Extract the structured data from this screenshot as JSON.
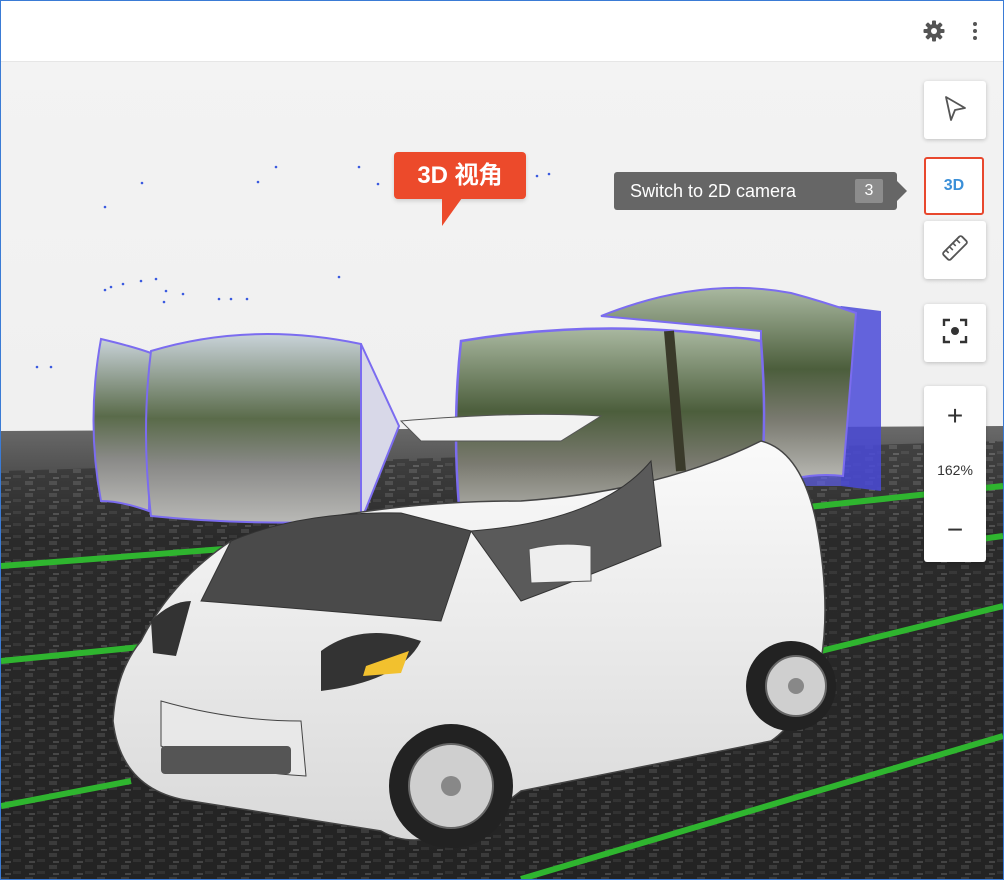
{
  "toolbar": {
    "settings_icon": "gear-icon",
    "more_icon": "more-vertical-icon"
  },
  "view_controls": {
    "select_tool_icon": "pointer-arrow-icon",
    "view_mode_label": "3D",
    "measure_tool_icon": "ruler-icon",
    "recenter_icon": "focus-target-icon",
    "zoom_in_label": "+",
    "zoom_level": "162%",
    "zoom_out_label": "−"
  },
  "tooltip": {
    "text": "Switch to 2D camera",
    "shortcut": "3"
  },
  "annotation": {
    "text": "3D 视角"
  },
  "colors": {
    "accent_red": "#ec4a2b",
    "frustum_purple": "#7b6cf0",
    "lane_green": "#2fb52f",
    "view_mode_blue": "#3a8fd8"
  }
}
